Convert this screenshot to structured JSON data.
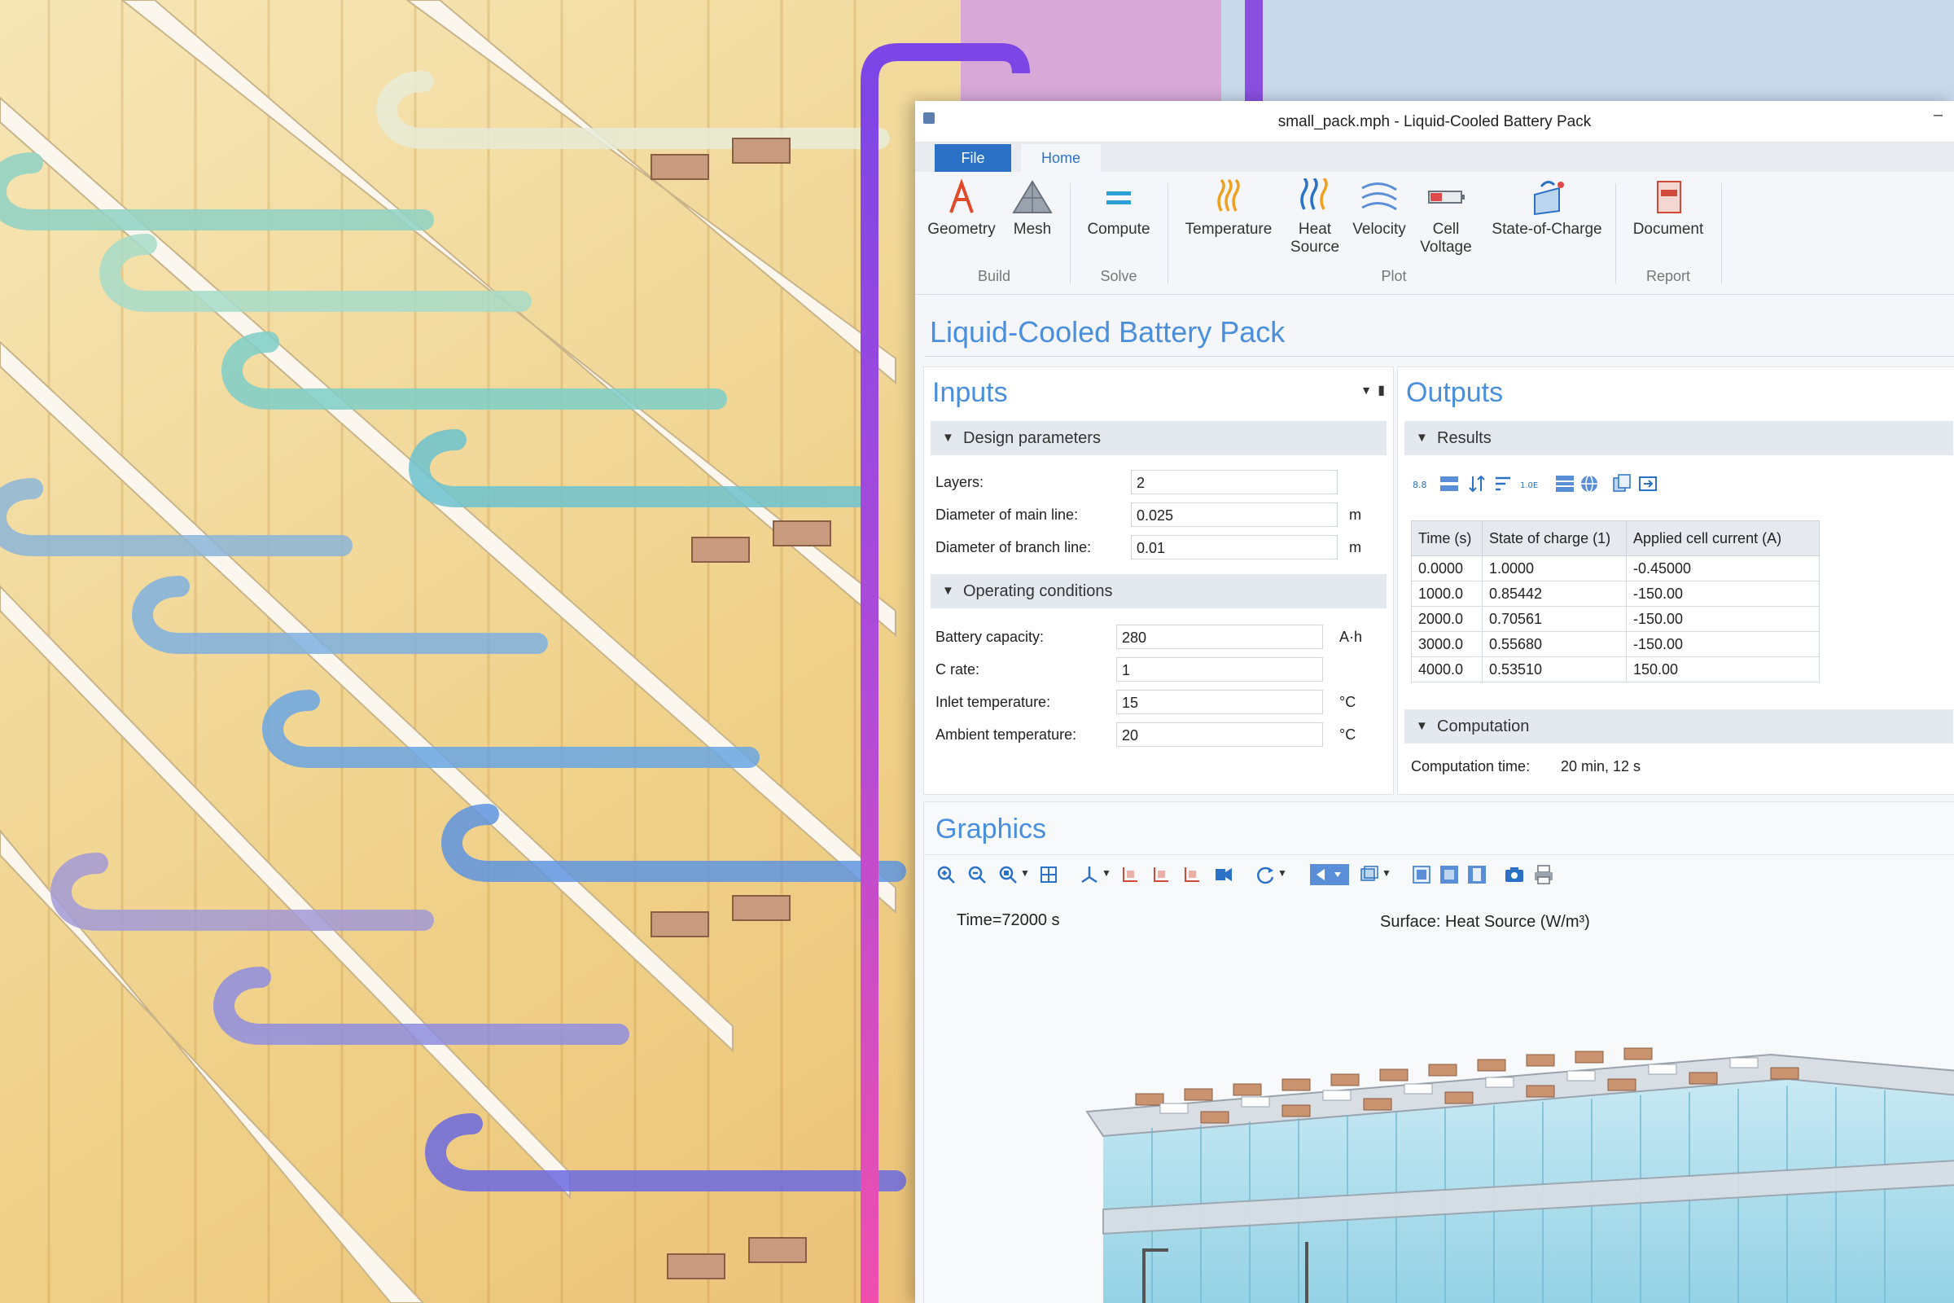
{
  "window": {
    "title": "small_pack.mph - Liquid-Cooled Battery Pack"
  },
  "tabs": [
    {
      "label": "File"
    },
    {
      "label": "Home"
    }
  ],
  "ribbon": {
    "buttons": [
      {
        "label": "Geometry",
        "icon": "geometry-icon"
      },
      {
        "label": "Mesh",
        "icon": "mesh-icon"
      },
      {
        "label": "Compute",
        "icon": "compute-icon"
      },
      {
        "label": "Temperature",
        "icon": "temperature-icon"
      },
      {
        "label": "Heat Source",
        "icon": "heat-source-icon"
      },
      {
        "label": "Velocity",
        "icon": "velocity-icon"
      },
      {
        "label": "Cell Voltage",
        "icon": "cell-voltage-icon"
      },
      {
        "label": "State-of-Charge",
        "icon": "state-of-charge-icon"
      },
      {
        "label": "Document",
        "icon": "document-icon"
      }
    ],
    "groups": [
      "Build",
      "Solve",
      "Plot",
      "Report"
    ]
  },
  "app_title": "Liquid-Cooled Battery Pack",
  "inputs": {
    "title": "Inputs",
    "design": {
      "heading": "Design parameters",
      "layers": {
        "label": "Layers:",
        "value": "2"
      },
      "main_line": {
        "label": "Diameter of main line:",
        "value": "0.025",
        "unit": "m"
      },
      "branch_line": {
        "label": "Diameter of branch line:",
        "value": "0.01",
        "unit": "m"
      }
    },
    "operating": {
      "heading": "Operating conditions",
      "capacity": {
        "label": "Battery capacity:",
        "value": "280",
        "unit": "A·h"
      },
      "crate": {
        "label": "C rate:",
        "value": "1"
      },
      "inlet": {
        "label": "Inlet temperature:",
        "value": "15",
        "unit": "°C"
      },
      "ambient": {
        "label": "Ambient temperature:",
        "value": "20",
        "unit": "°C"
      }
    }
  },
  "outputs": {
    "title": "Outputs",
    "results_heading": "Results",
    "columns": [
      "Time (s)",
      "State of charge (1)",
      "Applied cell current (A)"
    ],
    "rows": [
      [
        "0.0000",
        "1.0000",
        "-0.45000"
      ],
      [
        "1000.0",
        "0.85442",
        "-150.00"
      ],
      [
        "2000.0",
        "0.70561",
        "-150.00"
      ],
      [
        "3000.0",
        "0.55680",
        "-150.00"
      ],
      [
        "4000.0",
        "0.53510",
        "150.00"
      ]
    ],
    "computation_heading": "Computation",
    "computation_time_label": "Computation time:",
    "computation_time_value": "20 min, 12 s"
  },
  "graphics": {
    "title": "Graphics",
    "time_label": "Time=72000 s",
    "surface_label": "Surface: Heat Source (W/m³)"
  },
  "colors": {
    "accent": "#2b72c7",
    "title_blue": "#4a8fdc",
    "pipe_purple": "#8a4fe0",
    "pipe_pink": "#e040b0"
  }
}
